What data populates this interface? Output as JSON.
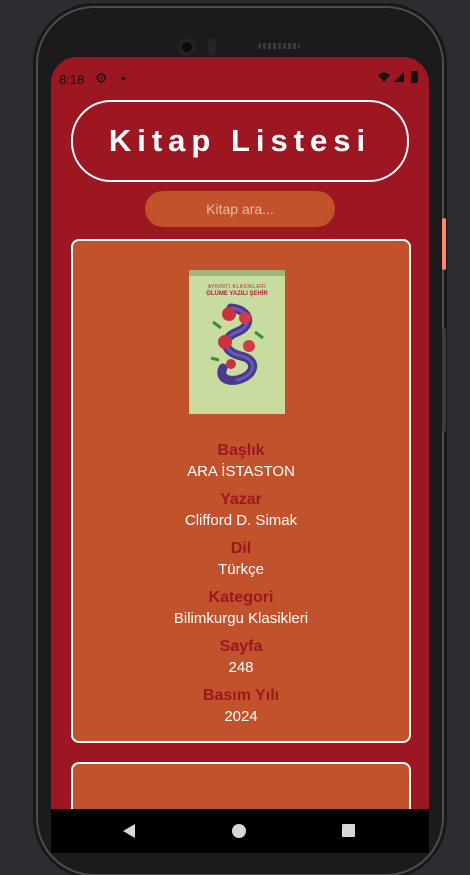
{
  "status_bar": {
    "time": "8:18",
    "icons": [
      "gear-icon",
      "dot-icon",
      "wifi-icon",
      "signal-icon",
      "battery-icon"
    ]
  },
  "header": {
    "title": "Kitap Listesi"
  },
  "search": {
    "placeholder": "Kitap ara..."
  },
  "book": {
    "cover": {
      "series_text": "AYRINTI KLASİKLERİ",
      "title_text": "ÖLÜME YAZILI ŞEHİR"
    },
    "fields": [
      {
        "label": "Başlık",
        "value": "ARA İSTASTON"
      },
      {
        "label": "Yazar",
        "value": "Clifford D. Simak"
      },
      {
        "label": "Dil",
        "value": "Türkçe"
      },
      {
        "label": "Kategori",
        "value": "Bilimkurgu Klasikleri"
      },
      {
        "label": "Sayfa",
        "value": "248"
      },
      {
        "label": "Basım Yılı",
        "value": "2024"
      }
    ]
  },
  "nav_bar": {
    "icons": [
      "back-icon",
      "home-icon",
      "recents-icon"
    ]
  },
  "colors": {
    "background": "#9d1723",
    "card": "#c2522b",
    "label": "#9d1723",
    "text": "#ffffff"
  }
}
